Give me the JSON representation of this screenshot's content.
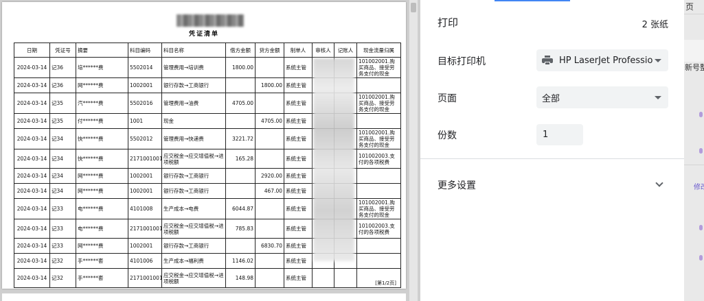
{
  "document": {
    "title": "",
    "subtitle": "凭证清单",
    "page_indicator": "[第1/2页]",
    "columns": [
      "日期",
      "凭证号",
      "摘要",
      "科目编码",
      "科目名称",
      "借方金额",
      "贷方金额",
      "制单人",
      "审核人",
      "记账人",
      "现金流量归属"
    ],
    "rows": [
      {
        "date": "2024-03-14",
        "no": "记36",
        "summary": "培******费",
        "code": "5502014",
        "account": "管理费用→培训费",
        "debit": "1800.00",
        "credit": "",
        "maker": "系统主管",
        "cashflow": "101002001.购买商品、接受劳务支付的现金"
      },
      {
        "date": "2024-03-14",
        "no": "记36",
        "summary": "网******费",
        "code": "1002001",
        "account": "银行存款→工商银行",
        "debit": "",
        "credit": "1800.00",
        "maker": "系统主管",
        "cashflow": ""
      },
      {
        "date": "2024-03-14",
        "no": "记35",
        "summary": "汽******费",
        "code": "5502016",
        "account": "管理费用→油费",
        "debit": "4705.00",
        "credit": "",
        "maker": "系统主管",
        "cashflow": "101002001.购买商品、接受劳务支付的现金"
      },
      {
        "date": "2024-03-14",
        "no": "记35",
        "summary": "付******费",
        "code": "1001",
        "account": "现金",
        "debit": "",
        "credit": "4705.00",
        "maker": "系统主管",
        "cashflow": ""
      },
      {
        "date": "2024-03-14",
        "no": "记34",
        "summary": "快******费",
        "code": "5502012",
        "account": "管理费用→快递费",
        "debit": "3221.72",
        "credit": "",
        "maker": "系统主管",
        "cashflow": "101002001.购买商品、接受劳务支付的现金"
      },
      {
        "date": "2024-03-14",
        "no": "记34",
        "summary": "快******费",
        "code": "2171001001",
        "account": "应交税金→应交增值税→进项税额",
        "debit": "165.28",
        "credit": "",
        "maker": "系统主管",
        "cashflow": "101002003.支付的各项税费"
      },
      {
        "date": "2024-03-14",
        "no": "记34",
        "summary": "网******费",
        "code": "1002001",
        "account": "银行存款→工商银行",
        "debit": "",
        "credit": "2920.00",
        "maker": "系统主管",
        "cashflow": ""
      },
      {
        "date": "2024-03-14",
        "no": "记34",
        "summary": "网******费",
        "code": "1002001",
        "account": "银行存款→工商银行",
        "debit": "",
        "credit": "467.00",
        "maker": "系统主管",
        "cashflow": ""
      },
      {
        "date": "2024-03-14",
        "no": "记33",
        "summary": "电******费",
        "code": "4101008",
        "account": "生产成本→电费",
        "debit": "6044.87",
        "credit": "",
        "maker": "系统主管",
        "cashflow": "101002001.购买商品、接受劳务支付的现金"
      },
      {
        "date": "2024-03-14",
        "no": "记33",
        "summary": "电******费",
        "code": "2171001001",
        "account": "应交税金→应交增值税→进项税额",
        "debit": "785.83",
        "credit": "",
        "maker": "系统主管",
        "cashflow": "101002003.支付的各项税费"
      },
      {
        "date": "2024-03-14",
        "no": "记33",
        "summary": "网******费",
        "code": "1002001",
        "account": "银行存款→工商银行",
        "debit": "",
        "credit": "6830.70",
        "maker": "系统主管",
        "cashflow": ""
      },
      {
        "date": "2024-03-14",
        "no": "记32",
        "summary": "手******套",
        "code": "4101006",
        "account": "生产成本→福利费",
        "debit": "1146.02",
        "credit": "",
        "maker": "系统主管",
        "cashflow": ""
      },
      {
        "date": "2024-03-14",
        "no": "记32",
        "summary": "手******套",
        "code": "2171001001",
        "account": "应交税金→应交增值税→进项税额",
        "debit": "148.98",
        "credit": "",
        "maker": "系统主管",
        "cashflow": ""
      }
    ]
  },
  "print_panel": {
    "title": "打印",
    "sheets": "2 张纸",
    "destination_label": "目标打印机",
    "destination_value": "HP LaserJet Professio",
    "pages_label": "页面",
    "pages_value": "全部",
    "copies_label": "份数",
    "copies_value": "1",
    "more_settings": "更多设置"
  },
  "background_app": {
    "snippet_top": "页",
    "snippet_mid": "新号整",
    "snippet_edit": "修改"
  },
  "colors": {
    "panel_select_bg": "#f1f3f4",
    "text_primary": "#202124",
    "icon_grey": "#5f6368",
    "preview_bg": "#cfcfcf"
  }
}
